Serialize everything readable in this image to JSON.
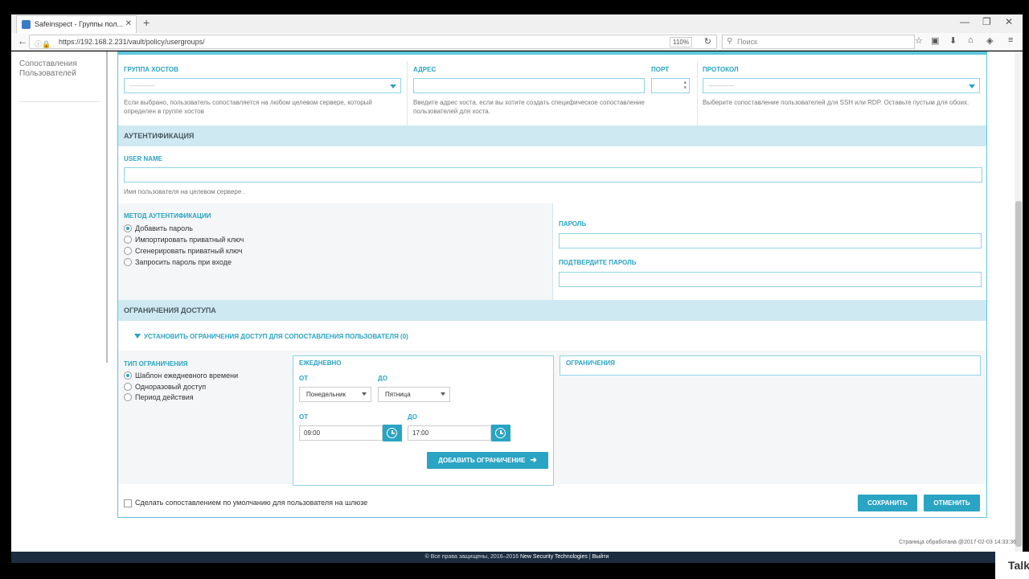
{
  "browser": {
    "tab_title": "Safeinspect - Группы пол...",
    "url": "https://192.168.2.231/vault/policy/usergroups/",
    "zoom": "110%",
    "search_placeholder": "Поиск"
  },
  "sidebar": {
    "item_label": "Сопоставления Пользователей"
  },
  "host_row": {
    "host_group_label": "ГРУППА ХОСТОВ",
    "host_group_value": "------------",
    "host_group_help": "Если выбрано, пользователь сопоставляется на любом целевом сервере, который определен в группе хостов",
    "address_label": "АДРЕС",
    "address_help": "Введите адрес хоста, если вы хотите создать специфическое сопоставление пользователей для хоста.",
    "port_label": "ПОРТ",
    "protocol_label": "ПРОТОКОЛ",
    "protocol_value": "------------",
    "protocol_help": "Выберите сопоставление пользователей для SSH или RDP. Оставьте пустым для обоих."
  },
  "auth": {
    "section_title": "АУТЕНТИФИКАЦИЯ",
    "username_label": "USER NAME",
    "username_help": "Имя пользователя на целевом сервере .",
    "method_label": "МЕТОД АУТЕНТИФИКАЦИИ",
    "methods": [
      {
        "label": "Добавить пароль",
        "selected": true
      },
      {
        "label": "Импортировать приватный ключ",
        "selected": false
      },
      {
        "label": "Сгенерировать приватный ключ",
        "selected": false
      },
      {
        "label": "Запросить пароль при входе",
        "selected": false
      }
    ],
    "password_label": "ПАРОЛЬ",
    "confirm_password_label": "ПОДТВЕРДИТЕ ПАРОЛЬ"
  },
  "access": {
    "section_title": "ОГРАНИЧЕНИЯ ДОСТУПА",
    "toggle_label": "УСТАНОВИТЬ ОГРАНИЧЕНИЯ ДОСТУП ДЛЯ СОПОСТАВЛЕНИЯ ПОЛЬЗОВАТЕЛЯ (0)",
    "type_label": "ТИП ОГРАНИЧЕНИЯ",
    "types": [
      {
        "label": "Шаблон ежедневного времени",
        "selected": true
      },
      {
        "label": "Одноразовый доступ",
        "selected": false
      },
      {
        "label": "Период действия",
        "selected": false
      }
    ],
    "daily_legend": "ЕЖЕДНЕВНО",
    "from_label": "ОТ",
    "to_label": "ДО",
    "from_day": "Понедельник",
    "to_day": "Пятница",
    "from_time": "09:00",
    "to_time": "17:00",
    "add_button": "ДОБАВИТЬ ОГРАНИЧЕНИЕ",
    "restrictions_legend": "ОГРАНИЧЕНИЯ"
  },
  "footer_row": {
    "default_checkbox_label": "Сделать сопоставлением по умолчанию для пользователя на шлюзе",
    "save_button": "СОХРАНИТЬ",
    "cancel_button": "ОТМЕНИТЬ"
  },
  "status_text": "Страница обработана @2017-02-03 14:33:36",
  "footer": {
    "copyright": "© Все права защищены, 2016–2016",
    "company": "New Security Technologies",
    "sep": "|",
    "lang": "Выйти"
  },
  "overlay_text": "Talk"
}
